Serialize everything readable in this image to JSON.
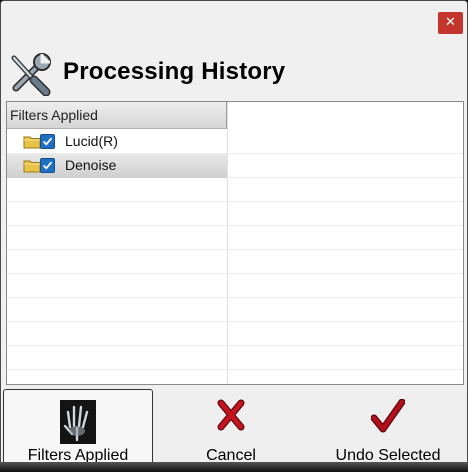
{
  "window": {
    "close_glyph": "✕"
  },
  "header": {
    "title": "Processing History",
    "icon": "tools-icon"
  },
  "tree": {
    "column_header": "Filters Applied",
    "items": [
      {
        "label": "Lucid(R)",
        "checked": true,
        "icon": "folder-icon",
        "selected": false
      },
      {
        "label": "Denoise",
        "checked": true,
        "icon": "folder-icon",
        "selected": true
      }
    ]
  },
  "toolbar": {
    "buttons": [
      {
        "label": "Filters Applied",
        "icon": "xray-hand-icon",
        "active": true
      },
      {
        "label": "Cancel",
        "icon": "cancel-x-icon",
        "active": false
      },
      {
        "label": "Undo Selected",
        "icon": "checkmark-icon",
        "active": false
      }
    ]
  },
  "colors": {
    "close_button": "#c4362d",
    "checkbox": "#1f6fc5",
    "cancel_icon": "#c8141e",
    "check_icon": "#b4101c"
  }
}
